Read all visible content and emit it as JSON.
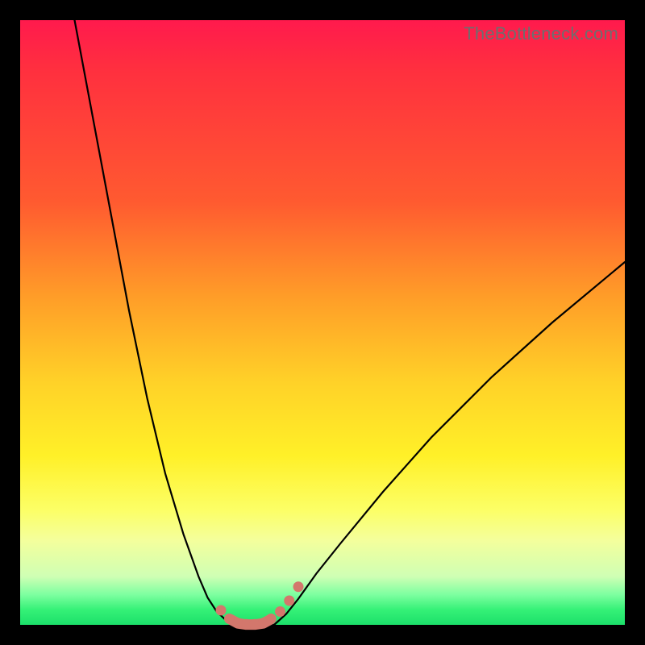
{
  "watermark": "TheBottleneck.com",
  "colors": {
    "background": "#000000",
    "gradient_top": "#ff1a4d",
    "gradient_mid1": "#ff9e28",
    "gradient_mid2": "#fff028",
    "gradient_bottom": "#1ce06a",
    "curve": "#000000",
    "markers": "#d3776c"
  },
  "chart_data": {
    "type": "line",
    "title": "",
    "xlabel": "",
    "ylabel": "",
    "xlim": [
      0,
      100
    ],
    "ylim": [
      0,
      100
    ],
    "curves": [
      {
        "name": "left-branch",
        "x": [
          9,
          12,
          15,
          18,
          21,
          24,
          27,
          29.5,
          31,
          32.5,
          34,
          35,
          36
        ],
        "y": [
          100,
          84,
          68,
          52,
          37.5,
          25,
          15,
          8,
          4.5,
          2.2,
          0.8,
          0.2,
          0
        ]
      },
      {
        "name": "valley",
        "x": [
          36,
          37,
          38,
          39,
          40,
          41,
          42
        ],
        "y": [
          0,
          0,
          0,
          0,
          0,
          0,
          0
        ]
      },
      {
        "name": "right-branch",
        "x": [
          42,
          44,
          46,
          49,
          53,
          60,
          68,
          78,
          88,
          100
        ],
        "y": [
          0,
          1.8,
          4.3,
          8.5,
          13.5,
          22,
          31,
          41,
          50,
          60
        ]
      }
    ],
    "markers": {
      "name": "valley-dots",
      "x": [
        33.2,
        34.6,
        36.0,
        37.4,
        38.8,
        40.2,
        41.5,
        43.0,
        44.5,
        46.0
      ],
      "y": [
        2.4,
        1.0,
        0.3,
        0.1,
        0.1,
        0.3,
        1.0,
        2.2,
        4.0,
        6.3
      ]
    },
    "marker_segment": {
      "name": "valley-segment",
      "x": [
        34.8,
        36.0,
        37.4,
        38.8,
        40.2,
        41.4
      ],
      "y": [
        0.9,
        0.25,
        0.05,
        0.05,
        0.25,
        0.9
      ]
    }
  }
}
